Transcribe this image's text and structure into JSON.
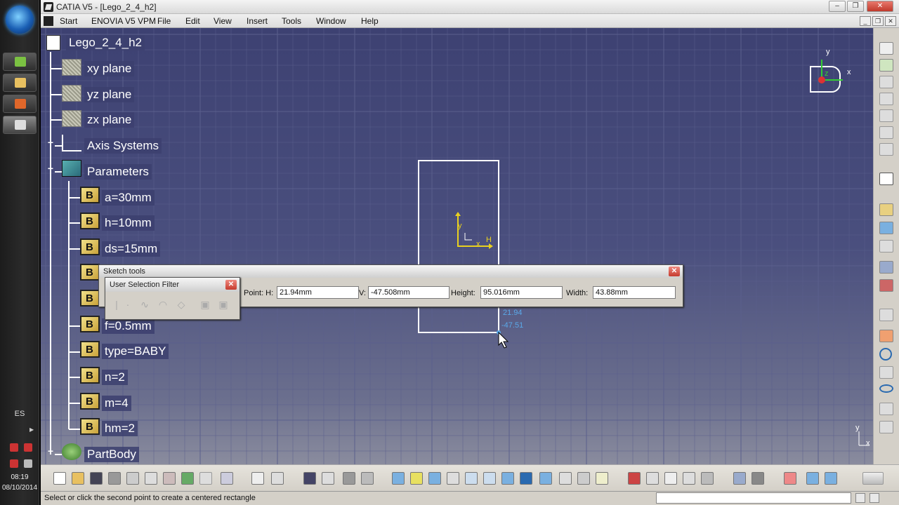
{
  "window": {
    "title": "CATIA V5 - [Lego_2_4_h2]",
    "minimize": "‒",
    "restore": "❐",
    "close": "✕"
  },
  "menu": [
    "Start",
    "ENOVIA V5 VPM",
    "File",
    "Edit",
    "View",
    "Insert",
    "Tools",
    "Window",
    "Help"
  ],
  "tree": {
    "root": "Lego_2_4_h2",
    "planes": [
      "xy plane",
      "yz plane",
      "zx plane"
    ],
    "axis_systems": "Axis Systems",
    "parameters": "Parameters",
    "params": [
      "a=30mm",
      "h=10mm",
      "ds=15mm",
      "f=0.5mm",
      "type=BABY",
      "n=2",
      "m=4",
      "hm=2"
    ],
    "part_body": "PartBody",
    "expand_plus": "+",
    "expand_minus": "−"
  },
  "sketch_tools": {
    "title": "Sketch tools",
    "close": "✕",
    "point_h_label": "Point: H:",
    "point_h_value": "21.94mm",
    "v_label": "V:",
    "v_value": "-47.508mm",
    "height_label": "Height:",
    "height_value": "95.016mm",
    "width_label": "Width:",
    "width_value": "43.88mm"
  },
  "user_selection_filter": {
    "title": "User Selection Filter",
    "close": "✕"
  },
  "viewport": {
    "compass_x": "x",
    "compass_y": "y",
    "compass_z": "z",
    "sketch_axis_h": "H",
    "sketch_axis_v": "y",
    "sketch_axis_x": "x",
    "cursor_h": "21.94",
    "cursor_v": "-47.51",
    "mini_axis_x": "x",
    "mini_axis_y": "y"
  },
  "statusbar": {
    "message": "Select or click the second point to create a centered rectangle"
  },
  "taskbar": {
    "language": "ES",
    "time": "08:19",
    "date": "08/10/2014"
  },
  "colors": {
    "viewport_top": "#3d4172",
    "grid": "#5a5f8c",
    "sketch_line": "#ffffff",
    "axis_yellow": "#e8d020",
    "cursor_blue": "#5aa8e8"
  }
}
